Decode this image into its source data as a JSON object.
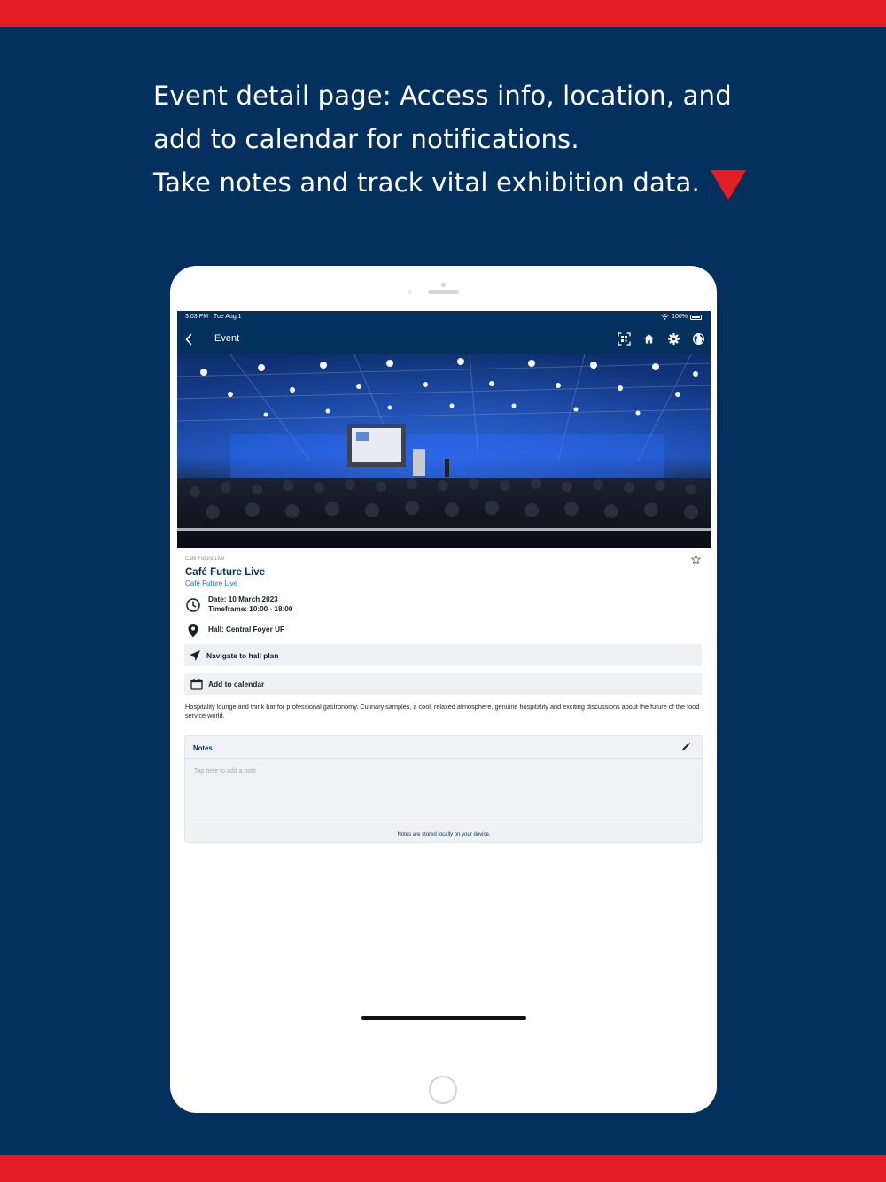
{
  "marketing": {
    "line1": "Event detail page: Access info, location, and",
    "line2": "add to calendar for notifications.",
    "line3": "Take notes and track vital exhibition data."
  },
  "colors": {
    "brand_navy": "#04305e",
    "accent_red": "#e01e24",
    "link_blue": "#2b6cb6"
  },
  "status_bar": {
    "time": "3:03 PM",
    "date": "Tue Aug 1",
    "battery": "100%"
  },
  "nav": {
    "title": "Event",
    "icons": [
      "back-icon",
      "qr-scan-icon",
      "home-icon",
      "gear-icon",
      "globe-icon"
    ]
  },
  "event": {
    "category": "Café Future Live",
    "title": "Café Future Live",
    "subtitle": "Café Future Live",
    "date": "Date: 10 March 2023",
    "timeframe": "Timeframe: 10:00 - 18:00",
    "hall": "Hall: Central Foyer UF",
    "description": "Hospitality lounge and think bar for professional gastronomy. Culinary samples, a cool, relaxed atmosphere, genuine hospitality and exciting discussions about the future of the food service world."
  },
  "actions": {
    "navigate": "Navigate to hall plan",
    "calendar": "Add to calendar"
  },
  "notes": {
    "title": "Notes",
    "placeholder": "Tap here to add a note",
    "footer": "Notes are stored locally on your device."
  }
}
